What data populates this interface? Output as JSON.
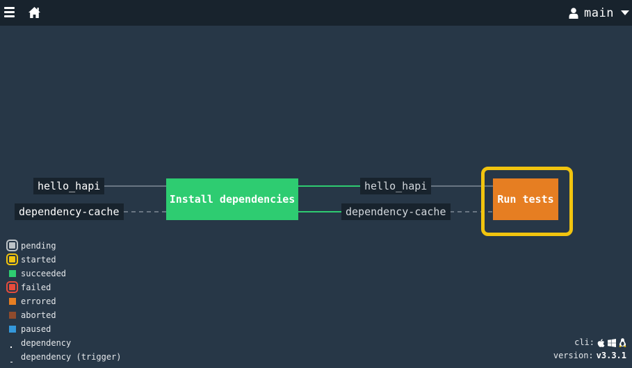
{
  "topbar": {
    "menu_icon": "hamburger-icon",
    "home_icon": "home-icon",
    "user_icon": "user-icon",
    "pipeline_name": "main",
    "caret_icon": "caret-down-icon"
  },
  "graph": {
    "inputs": [
      {
        "name": "hello_hapi",
        "kind": "trigger"
      },
      {
        "name": "dependency-cache",
        "kind": "dependency"
      }
    ],
    "jobs": [
      {
        "name": "Install dependencies",
        "status": "succeeded"
      },
      {
        "name": "Run tests",
        "status": "errored",
        "running": "started"
      }
    ],
    "outputs": [
      {
        "name": "hello_hapi"
      },
      {
        "name": "dependency-cache"
      }
    ]
  },
  "legend": [
    {
      "label": "pending",
      "color": "#bdc3c7"
    },
    {
      "label": "started",
      "color": "#f1c40f"
    },
    {
      "label": "succeeded",
      "color": "#2ecc71"
    },
    {
      "label": "failed",
      "color": "#e74c3c"
    },
    {
      "label": "errored",
      "color": "#e67e22"
    },
    {
      "label": "aborted",
      "color": "#8f4b2d"
    },
    {
      "label": "paused",
      "color": "#3498db"
    },
    {
      "label": "dependency"
    },
    {
      "label": "dependency (trigger)"
    }
  ],
  "footer": {
    "cli_label": "cli:",
    "cli_icons": [
      "apple-icon",
      "windows-icon",
      "linux-icon"
    ],
    "version_label": "version:",
    "version_value": "v3.3.1"
  },
  "colors": {
    "background": "#273747",
    "topbar": "#18232d",
    "succeeded": "#2ecc71",
    "errored": "#e67e22",
    "started": "#f1c40f",
    "edge_trigger": "#6a7683",
    "edge_dependency": "#6a7683",
    "edge_output": "#2ecc71"
  }
}
